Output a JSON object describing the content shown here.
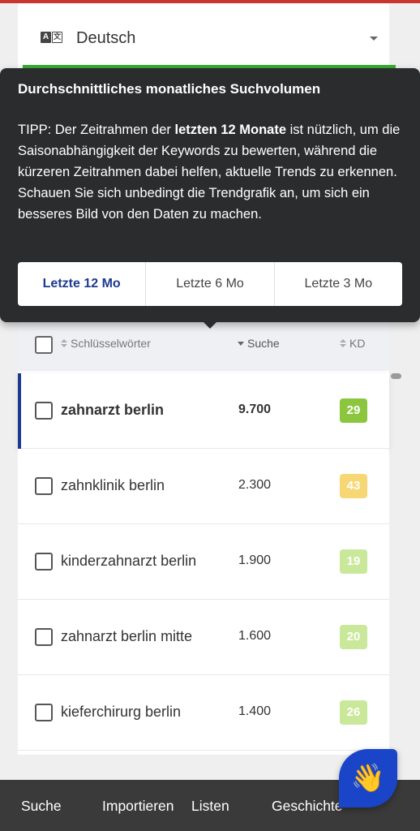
{
  "language": {
    "icon": "translate-icon",
    "icon_glyph_a": "A",
    "icon_glyph_b": "文",
    "value": "Deutsch"
  },
  "tooltip": {
    "title": "Durchschnittliches monatliches Suchvolumen",
    "body_prefix": "TIPP: Der Zeitrahmen der ",
    "body_bold": "letzten 12 Monate",
    "body_suffix": " ist nützlich, um die Saisonabhängigkeit der Keywords zu bewerten, während die kürzeren Zeitrahmen dabei helfen, aktuelle Trends zu erkennen. Schauen Sie sich unbedingt die Trendgrafik an, um sich ein besseres Bild von den Daten zu machen.",
    "periods": [
      {
        "label": "Letzte 12 Mo",
        "active": true
      },
      {
        "label": "Letzte 6 Mo",
        "active": false
      },
      {
        "label": "Letzte 3 Mo",
        "active": false
      }
    ]
  },
  "table": {
    "columns": {
      "keywords": "Schlüsselwörter",
      "search": "Suche",
      "kd": "KD"
    },
    "rows": [
      {
        "keyword": "zahnarzt berlin",
        "volume": "9.700",
        "kd": "29",
        "kd_color": "#8cc63f"
      },
      {
        "keyword": "zahnklinik berlin",
        "volume": "2.300",
        "kd": "43",
        "kd_color": "#f7d774"
      },
      {
        "keyword": "kinderzahnarzt berlin",
        "volume": "1.900",
        "kd": "19",
        "kd_color": "#c9e89a"
      },
      {
        "keyword": "zahnarzt berlin mitte",
        "volume": "1.600",
        "kd": "20",
        "kd_color": "#c9e89a"
      },
      {
        "keyword": "kieferchirurg berlin",
        "volume": "1.400",
        "kd": "26",
        "kd_color": "#c9e89a"
      }
    ]
  },
  "bottom_nav": {
    "items": [
      "Suche",
      "Importieren",
      "Listen",
      "Geschichte"
    ]
  },
  "fab": {
    "icon": "waving-hand-icon",
    "emoji": "👋"
  },
  "colors": {
    "accent": "#1d3a8f",
    "green": "#3aaa35",
    "top_bar": "#c9362f",
    "fab": "#1a45c8"
  }
}
